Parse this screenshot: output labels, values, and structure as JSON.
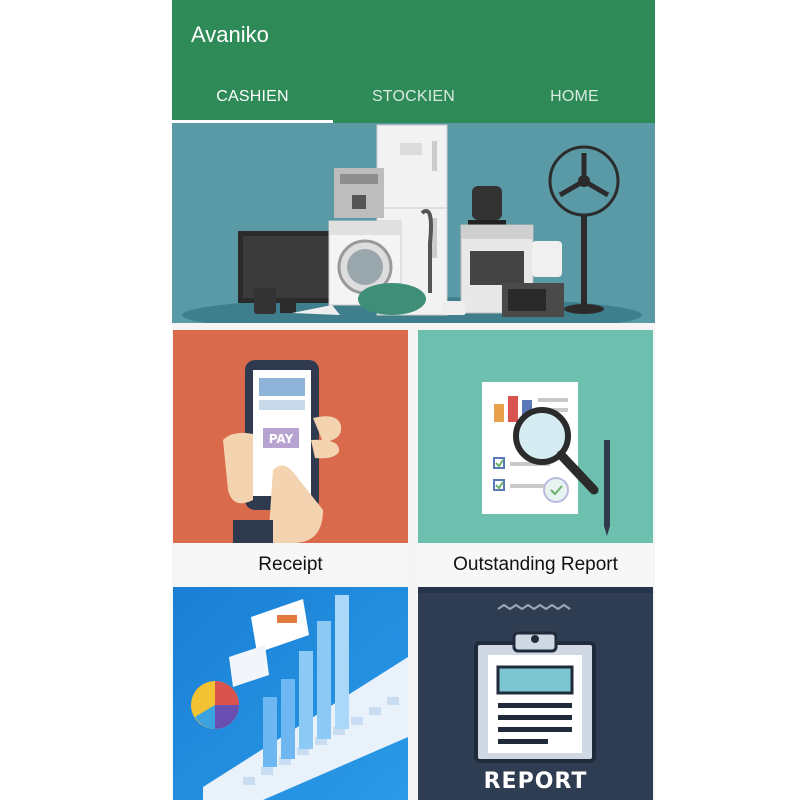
{
  "app": {
    "title": "Avaniko"
  },
  "tabs": [
    {
      "label": "CASHIEN",
      "active": true
    },
    {
      "label": "STOCKIEN",
      "active": false
    },
    {
      "label": "HOME",
      "active": false
    }
  ],
  "tiles": [
    {
      "label": "Receipt",
      "icon": "pay-phone-icon"
    },
    {
      "label": "Outstanding Report",
      "icon": "magnifier-report-icon"
    },
    {
      "label": "",
      "icon": "analytics-keyboard-icon"
    },
    {
      "label": "",
      "icon": "clipboard-report-icon",
      "image_text": "REPORT"
    }
  ],
  "colors": {
    "appbar": "#2e8b57",
    "banner_bg": "#5a9aa6",
    "receipt_bg": "#d96a4b",
    "outstanding_bg": "#6dbfae",
    "analytics_bg": "#1e88d9",
    "report_bg": "#2f3d52"
  },
  "banner": {
    "icon": "home-appliances-illustration"
  }
}
